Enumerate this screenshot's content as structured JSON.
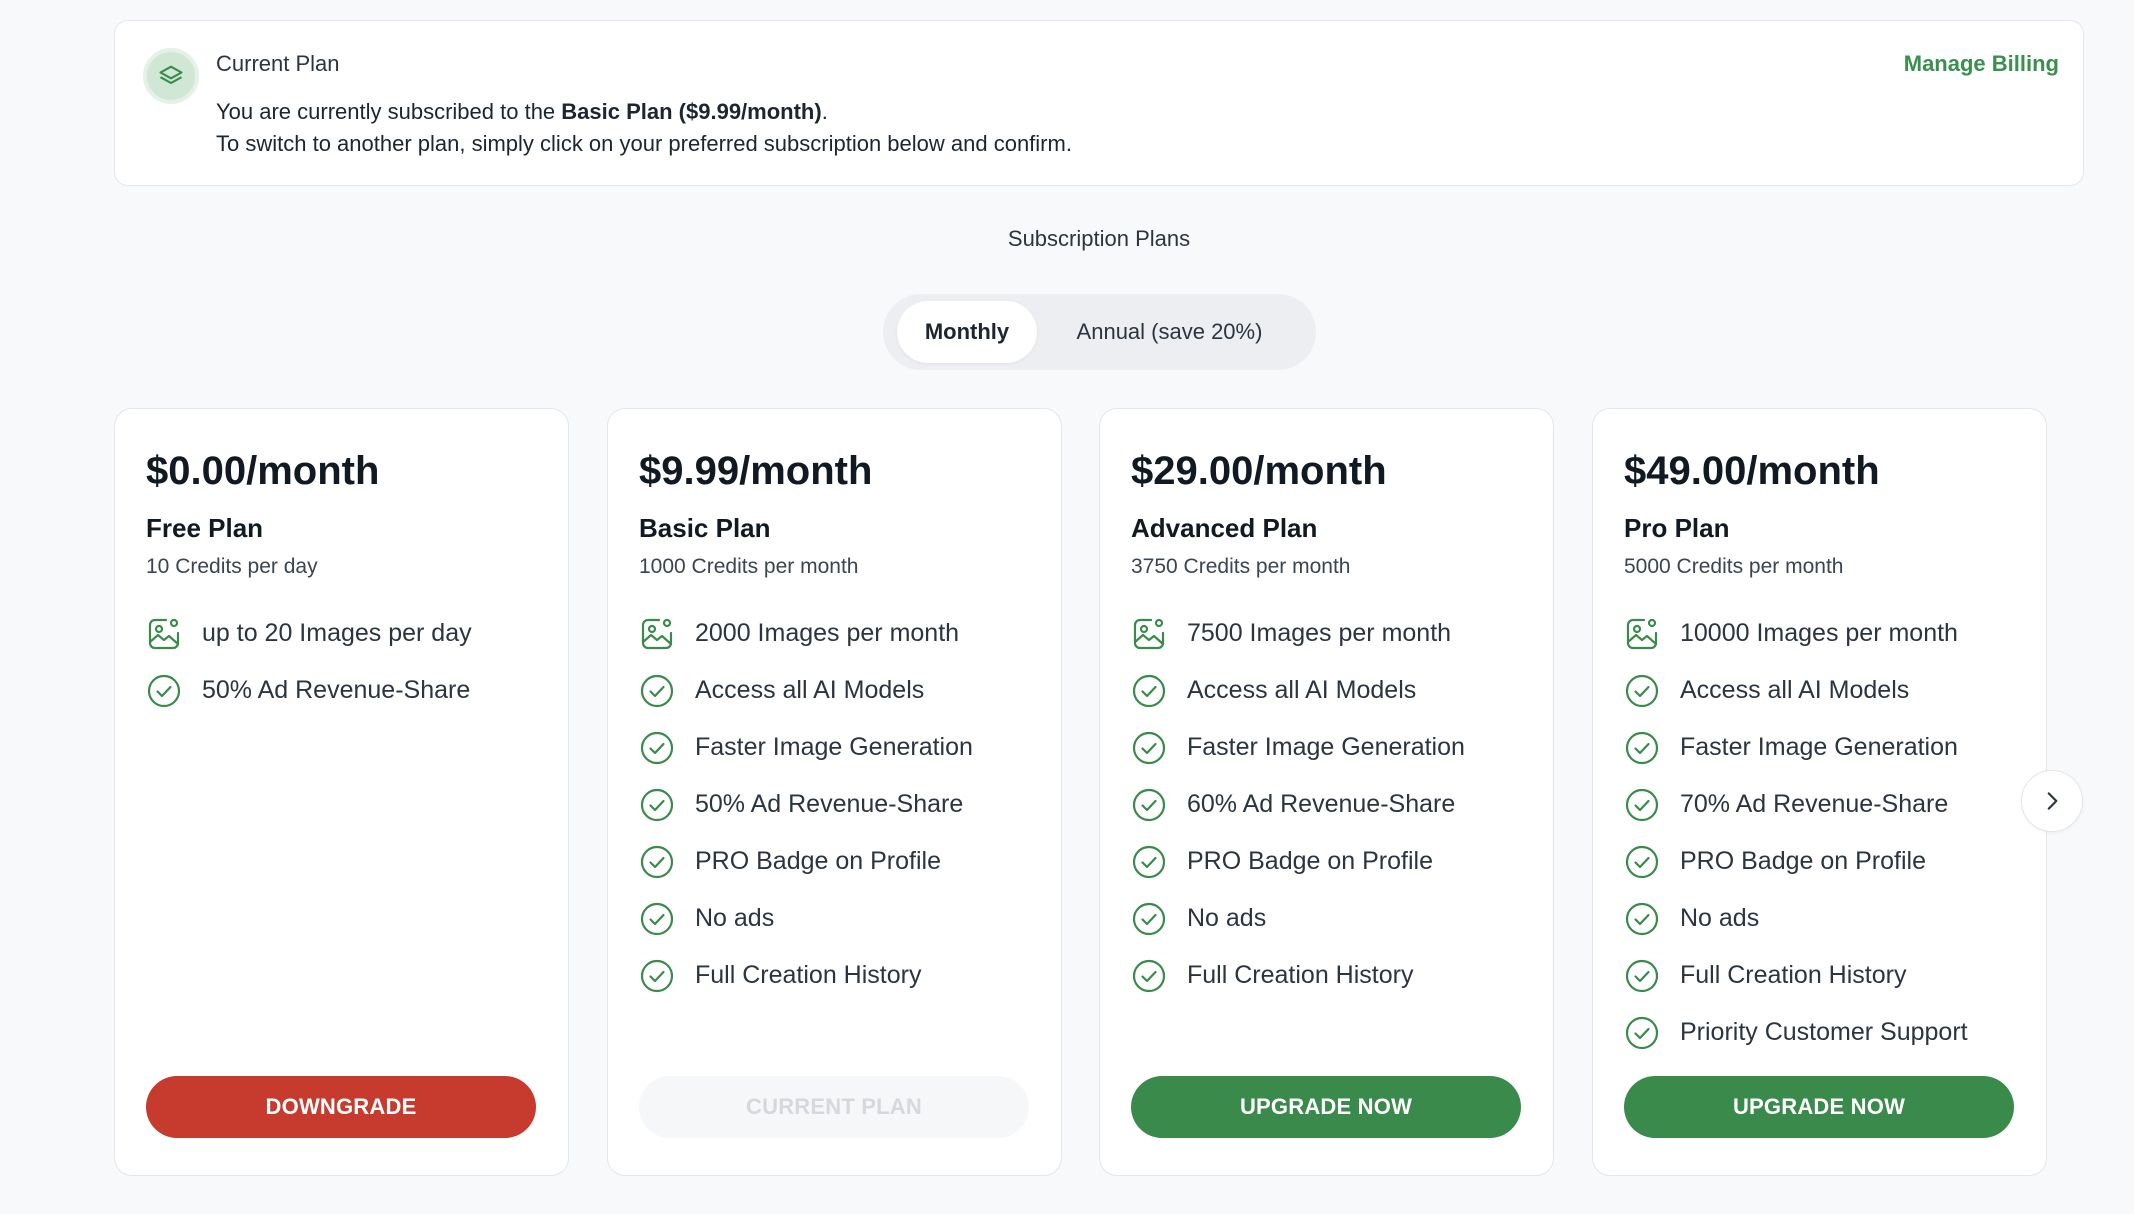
{
  "current_plan": {
    "badge_icon": "layers-icon",
    "title": "Current Plan",
    "line1_prefix": "You are currently subscribed to the ",
    "line1_plan": "Basic Plan ($9.99/month)",
    "line1_suffix": ".",
    "line2": "To switch to another plan, simply click on your preferred subscription below and confirm.",
    "manage_billing": "Manage Billing"
  },
  "subscription_title": "Subscription Plans",
  "billing_toggle": {
    "monthly": "Monthly",
    "annual": "Annual (save 20%)",
    "selected": "Monthly"
  },
  "colors": {
    "accent_green": "#3a8a4c",
    "danger_red": "#c63b2e",
    "link_green": "#3a8f4f"
  },
  "plans": [
    {
      "price": "$0.00/month",
      "name": "Free Plan",
      "credits": "10 Credits per day",
      "features": [
        {
          "icon": "image-icon",
          "text": "up to 20 Images per day"
        },
        {
          "icon": "check-circle-icon",
          "text": "50% Ad Revenue-Share"
        }
      ],
      "button": "DOWNGRADE",
      "button_style": "red"
    },
    {
      "price": "$9.99/month",
      "name": "Basic Plan",
      "credits": "1000 Credits per month",
      "features": [
        {
          "icon": "image-icon",
          "text": "2000 Images per month"
        },
        {
          "icon": "check-circle-icon",
          "text": "Access all AI Models"
        },
        {
          "icon": "check-circle-icon",
          "text": "Faster Image Generation"
        },
        {
          "icon": "check-circle-icon",
          "text": "50% Ad Revenue-Share"
        },
        {
          "icon": "check-circle-icon",
          "text": "PRO Badge on Profile"
        },
        {
          "icon": "check-circle-icon",
          "text": "No ads"
        },
        {
          "icon": "check-circle-icon",
          "text": "Full Creation History"
        }
      ],
      "button": "CURRENT PLAN",
      "button_style": "disabled"
    },
    {
      "price": "$29.00/month",
      "name": "Advanced Plan",
      "credits": "3750 Credits per month",
      "features": [
        {
          "icon": "image-icon",
          "text": "7500 Images per month"
        },
        {
          "icon": "check-circle-icon",
          "text": "Access all AI Models"
        },
        {
          "icon": "check-circle-icon",
          "text": "Faster Image Generation"
        },
        {
          "icon": "check-circle-icon",
          "text": "60% Ad Revenue-Share"
        },
        {
          "icon": "check-circle-icon",
          "text": "PRO Badge on Profile"
        },
        {
          "icon": "check-circle-icon",
          "text": "No ads"
        },
        {
          "icon": "check-circle-icon",
          "text": "Full Creation History"
        }
      ],
      "button": "UPGRADE NOW",
      "button_style": "green"
    },
    {
      "price": "$49.00/month",
      "name": "Pro Plan",
      "credits": "5000 Credits per month",
      "features": [
        {
          "icon": "image-icon",
          "text": "10000 Images per month"
        },
        {
          "icon": "check-circle-icon",
          "text": "Access all AI Models"
        },
        {
          "icon": "check-circle-icon",
          "text": "Faster Image Generation"
        },
        {
          "icon": "check-circle-icon",
          "text": "70% Ad Revenue-Share"
        },
        {
          "icon": "check-circle-icon",
          "text": "PRO Badge on Profile"
        },
        {
          "icon": "check-circle-icon",
          "text": "No ads"
        },
        {
          "icon": "check-circle-icon",
          "text": "Full Creation History"
        },
        {
          "icon": "check-circle-icon",
          "text": "Priority Customer Support"
        }
      ],
      "button": "UPGRADE NOW",
      "button_style": "green"
    }
  ],
  "carousel_next_icon": "chevron-right-icon"
}
